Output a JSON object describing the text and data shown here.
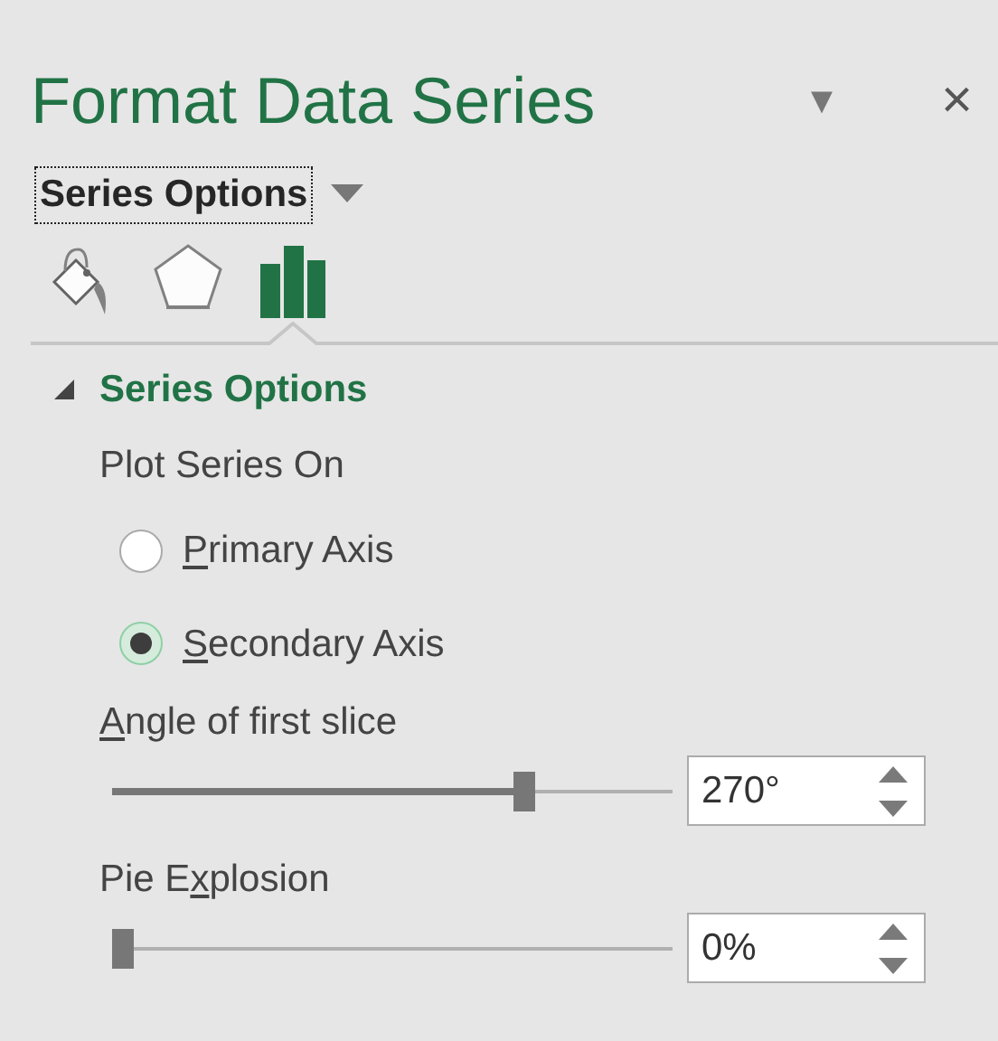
{
  "pane": {
    "title": "Format Data Series",
    "menu_arrow": "▾",
    "close": "×"
  },
  "options_dropdown": {
    "value": "Series Options"
  },
  "tabs": [
    {
      "kind": "fill",
      "selected": false
    },
    {
      "kind": "effects",
      "selected": false
    },
    {
      "kind": "series",
      "selected": true
    }
  ],
  "section": {
    "title": "Series Options",
    "expanded": true,
    "plot_series_on": {
      "label": "Plot Series On",
      "options": [
        {
          "key": "P",
          "rest": "rimary Axis",
          "selected": false
        },
        {
          "key": "S",
          "rest": "econdary Axis",
          "selected": true
        }
      ]
    },
    "sliders": [
      {
        "key": "A",
        "after": "ngle of first slice",
        "level": 0.75,
        "value": "270°"
      },
      {
        "before": "Pie E",
        "key": "x",
        "after": "plosion",
        "level": 0,
        "value": "0%"
      }
    ]
  }
}
